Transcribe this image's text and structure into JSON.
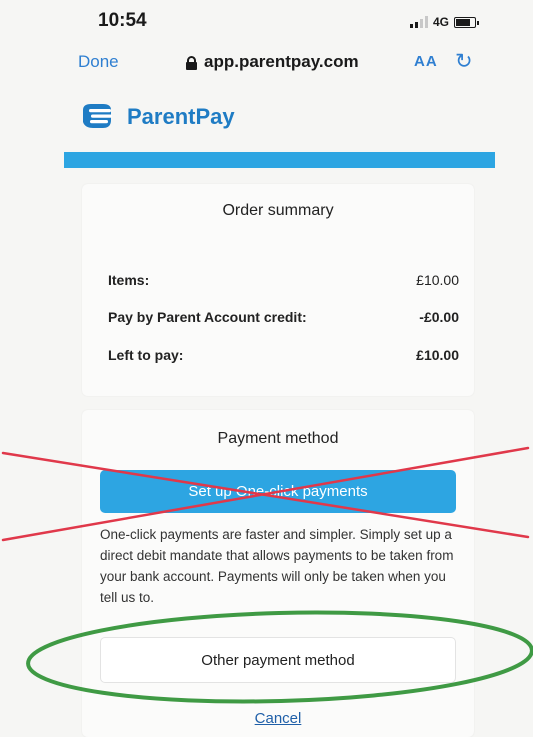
{
  "status_bar": {
    "time": "10:54",
    "network": "4G"
  },
  "browser": {
    "done_label": "Done",
    "url": "app.parentpay.com",
    "text_size_label": "AA"
  },
  "brand": {
    "name": "ParentPay",
    "color": "#1f7cc4",
    "band_color": "#2da5e2"
  },
  "order_summary": {
    "title": "Order summary",
    "rows": [
      {
        "label": "Items:",
        "value": "£10.00"
      },
      {
        "label": "Pay by Parent Account credit:",
        "value": "-£0.00"
      },
      {
        "label": "Left to pay:",
        "value": "£10.00"
      }
    ]
  },
  "payment_method": {
    "title": "Payment method",
    "one_click_button": "Set up One-click payments",
    "description": "One-click payments are faster and simpler. Simply set up a direct debit mandate that allows payments to be taken from your bank account. Payments will only be taken when you tell us to.",
    "other_button": "Other payment method",
    "cancel_label": "Cancel"
  },
  "annotations": {
    "cross_color": "#e0384a",
    "circle_color": "#3f9a44"
  }
}
